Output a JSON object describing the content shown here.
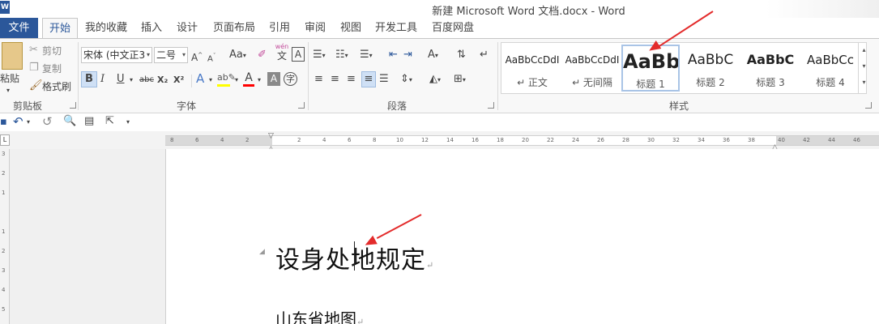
{
  "window": {
    "title": "新建 Microsoft Word 文档.docx - Word",
    "logo_letter": "W"
  },
  "tabs": [
    {
      "label": "文件",
      "kind": "file"
    },
    {
      "label": "开始",
      "kind": "active"
    },
    {
      "label": "我的收藏",
      "kind": "normal"
    },
    {
      "label": "插入",
      "kind": "normal"
    },
    {
      "label": "设计",
      "kind": "normal"
    },
    {
      "label": "页面布局",
      "kind": "normal"
    },
    {
      "label": "引用",
      "kind": "normal"
    },
    {
      "label": "审阅",
      "kind": "normal"
    },
    {
      "label": "视图",
      "kind": "normal"
    },
    {
      "label": "开发工具",
      "kind": "normal"
    },
    {
      "label": "百度网盘",
      "kind": "normal"
    }
  ],
  "clipboard": {
    "group_label": "剪贴板",
    "paste": "粘贴",
    "cut": "剪切",
    "copy": "复制",
    "format_painter": "格式刷"
  },
  "font": {
    "group_label": "字体",
    "font_name": "宋体 (中文正3",
    "font_size": "二号",
    "change_case": "Aa",
    "phonetic_top": "wén",
    "phonetic_bottom": "文",
    "bold": "B",
    "italic": "I",
    "underline": "U",
    "strike": "abc",
    "subscript": "X₂",
    "superscript": "X²"
  },
  "paragraph": {
    "group_label": "段落"
  },
  "styles": {
    "group_label": "样式",
    "items": [
      {
        "sample": "AaBbCcDdI",
        "name": "↵ 正文"
      },
      {
        "sample": "AaBbCcDdI",
        "name": "↵ 无间隔"
      },
      {
        "sample": "AaBb",
        "name": "标题 1"
      },
      {
        "sample": "AaBbC",
        "name": "标题 2"
      },
      {
        "sample": "AaBbC",
        "name": "标题 3"
      },
      {
        "sample": "AaBbCc",
        "name": "标题 4"
      }
    ],
    "selected_index": 2
  },
  "ruler": {
    "ticks_left": [
      "8",
      "6",
      "4",
      "2"
    ],
    "ticks_right": [
      "2",
      "4",
      "6",
      "8",
      "10",
      "12",
      "14",
      "16",
      "18",
      "20",
      "22",
      "24",
      "26",
      "28",
      "30",
      "32",
      "34",
      "36",
      "38",
      "40",
      "42",
      "44",
      "46"
    ],
    "tab_selector": "L"
  },
  "vruler": {
    "ticks": [
      "3",
      "2",
      "1",
      "1",
      "2",
      "3",
      "4",
      "5"
    ]
  },
  "document": {
    "heading": "设身处地规定",
    "body": "山东省地图",
    "paragraph_mark": "↵"
  },
  "colors": {
    "accent": "#2b579a",
    "arrow": "#e32b2b",
    "highlight": "#ffff00",
    "font_color": "#ff0000"
  }
}
